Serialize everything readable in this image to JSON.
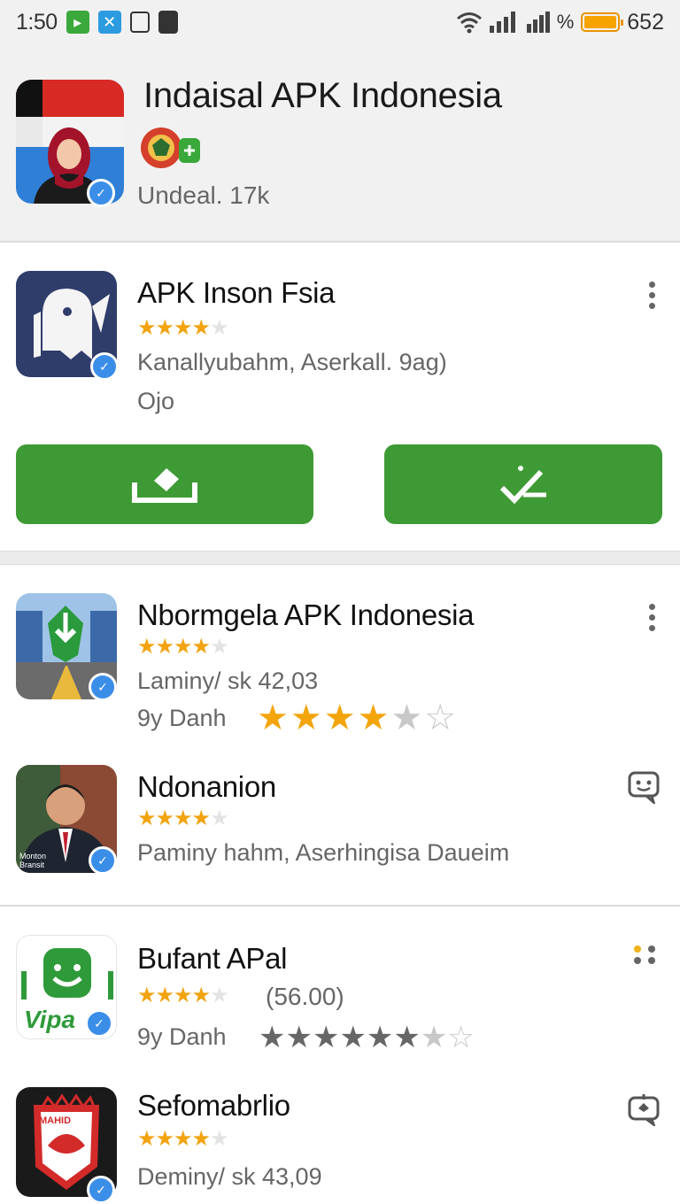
{
  "status_bar": {
    "time": "1:50",
    "battery_text": "652",
    "signal_text": "%"
  },
  "header": {
    "title": "Indaisal APK Indonesia",
    "subtitle": "Undeal. 17k"
  },
  "featured": {
    "name": "APK Inson Fsia",
    "rating": 4,
    "meta": "Kanallyubahm, Aserkall. 9ag)",
    "sub": "Ojo",
    "buttons": [
      {
        "name": "install-button",
        "icon": "tray-download-icon"
      },
      {
        "name": "installed-check-button",
        "icon": "checkmark-pen-icon"
      }
    ]
  },
  "apps": [
    {
      "name": "Nbormgela APK Indonesia",
      "rating": 3.5,
      "meta": "Laminy/ sk  42,03",
      "meta2": "9y Danh",
      "big_rating": 4
    },
    {
      "name": "Ndonanion",
      "rating": 4,
      "meta": "Paminy hahm,  Aserhingisa Daueim",
      "icon_caption": "Monton Bransit"
    },
    {
      "name": "Bufant APal",
      "rating": 3.5,
      "meta": "(56.00)",
      "meta2": "9y Danh",
      "big_rating": 6
    },
    {
      "name": "Sefomabrlio",
      "rating": 4,
      "meta": "Deminy/ sk  43,09",
      "icon_caption": "MAHID"
    }
  ],
  "colors": {
    "install_green": "#3e9a34",
    "star_orange": "#f2a30f",
    "verified_blue": "#3b8ee8"
  }
}
